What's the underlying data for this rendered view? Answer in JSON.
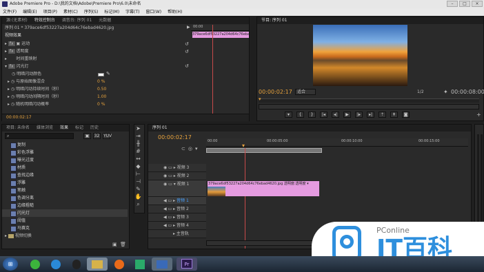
{
  "titlebar": {
    "title": "Adobe Premiere Pro - D:\\我的文档\\Adobe\\Premiere Pro\\6.0\\未命名"
  },
  "menu": [
    "文件(F)",
    "编辑(E)",
    "项目(P)",
    "素材(C)",
    "序列(S)",
    "标记(M)",
    "字幕(T)",
    "窗口(W)",
    "帮助(H)"
  ],
  "effect_controls": {
    "tabs": [
      "源:(无素材)",
      "特效控制台",
      "调音台: 序列 01",
      "元数据"
    ],
    "sequence_label": "序列 01 * 379ace6df53227a204d64c76ebad4620.jpg",
    "ruler_time": "00:00",
    "clip_name": "379ace6df53227a204d64c76ebad4620.jpg",
    "section": "视频效果",
    "items": [
      "运动",
      "透明度",
      "时间重映射",
      "闪光灯"
    ],
    "params": [
      {
        "label": "明暗闪动颜色",
        "value": ""
      },
      {
        "label": "与原始图像混合",
        "value": "0 %"
      },
      {
        "label": "明暗闪动持续时间（秒）",
        "value": "0.50"
      },
      {
        "label": "明暗闪动间隔时间（秒）",
        "value": "1.00"
      },
      {
        "label": "随机明暗闪动概率",
        "value": "0 %"
      }
    ],
    "timecode": "00:00:02:17"
  },
  "program_monitor": {
    "tab": "节目: 序列 01",
    "timecode": "00:00:02:17",
    "fit": "适合",
    "ratio": "1/2",
    "duration": "00:00:08:00"
  },
  "project_panel": {
    "tabs": [
      "项目: 未命名",
      "媒体浏览",
      "效果",
      "标记",
      "历史"
    ],
    "items": [
      "复制",
      "彩色浮雕",
      "曝光过度",
      "材质",
      "查找边缘",
      "浮雕",
      "笔触",
      "色调分离",
      "边缘粗糙",
      "闪光灯",
      "阈值",
      "马赛克"
    ],
    "footer": "视频切换"
  },
  "timeline": {
    "tab": "序列 01",
    "timecode": "00:00:02:17",
    "ruler_labels": [
      "00:00",
      "00:00:05:00",
      "00:00:10:00",
      "00:00:15:00"
    ],
    "tracks": [
      "视频 3",
      "视频 2",
      "视频 1",
      "音频 1",
      "音频 2",
      "音频 3",
      "音频 4",
      "主音轨"
    ],
    "clip_label": "379ace6df53227a204d64c76ebad4620.jpg  透明度:透明度 ▾"
  },
  "watermark": {
    "brand": "PConline",
    "sub": "IT百科"
  },
  "taskbar": {
    "pr_label": "Pr"
  }
}
